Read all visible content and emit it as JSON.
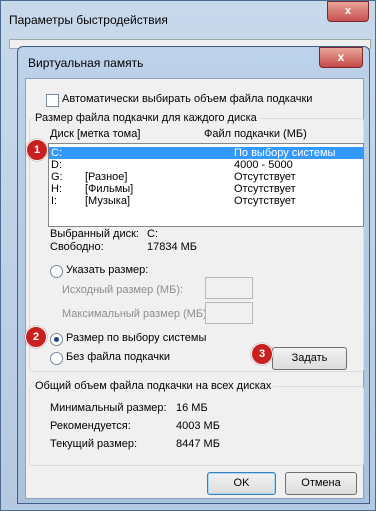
{
  "outer_window": {
    "title": "Параметры быстродействия",
    "close": "x"
  },
  "dialog": {
    "title": "Виртуальная память",
    "close": "x",
    "auto_checkbox_label": "Автоматически выбирать объем файла подкачки",
    "group1_label": "Размер файла подкачки для каждого диска",
    "columns": {
      "disk": "Диск [метка тома]",
      "pagefile": "Файл подкачки (МБ)"
    },
    "drives": [
      {
        "drive": "C:",
        "label": "",
        "value": "По выбору системы",
        "selected": true
      },
      {
        "drive": "D:",
        "label": "",
        "value": "4000 - 5000",
        "selected": false
      },
      {
        "drive": "G:",
        "label": "[Разное]",
        "value": "Отсутствует",
        "selected": false
      },
      {
        "drive": "H:",
        "label": "[Фильмы]",
        "value": "Отсутствует",
        "selected": false
      },
      {
        "drive": "I:",
        "label": "[Музыка]",
        "value": "Отсутствует",
        "selected": false
      }
    ],
    "selected_disk_label": "Выбранный диск:",
    "selected_disk_value": "C:",
    "free_label": "Свободно:",
    "free_value": "17834 МБ",
    "custom_size_label": "Указать размер:",
    "initial_size_label": "Исходный размер (МБ):",
    "max_size_label": "Максимальный размер (МБ):",
    "system_size_label": "Размер по выбору системы",
    "no_pagefile_label": "Без файла подкачки",
    "set_button": "Задать",
    "group2_label": "Общий объем файла подкачки на всех дисках",
    "min_label": "Минимальный размер:",
    "min_value": "16 МБ",
    "recommended_label": "Рекомендуется:",
    "recommended_value": "4003 МБ",
    "current_label": "Текущий размер:",
    "current_value": "8447 МБ",
    "ok_button": "OK",
    "cancel_button": "Отмена"
  },
  "badges": [
    "1",
    "2",
    "3"
  ]
}
